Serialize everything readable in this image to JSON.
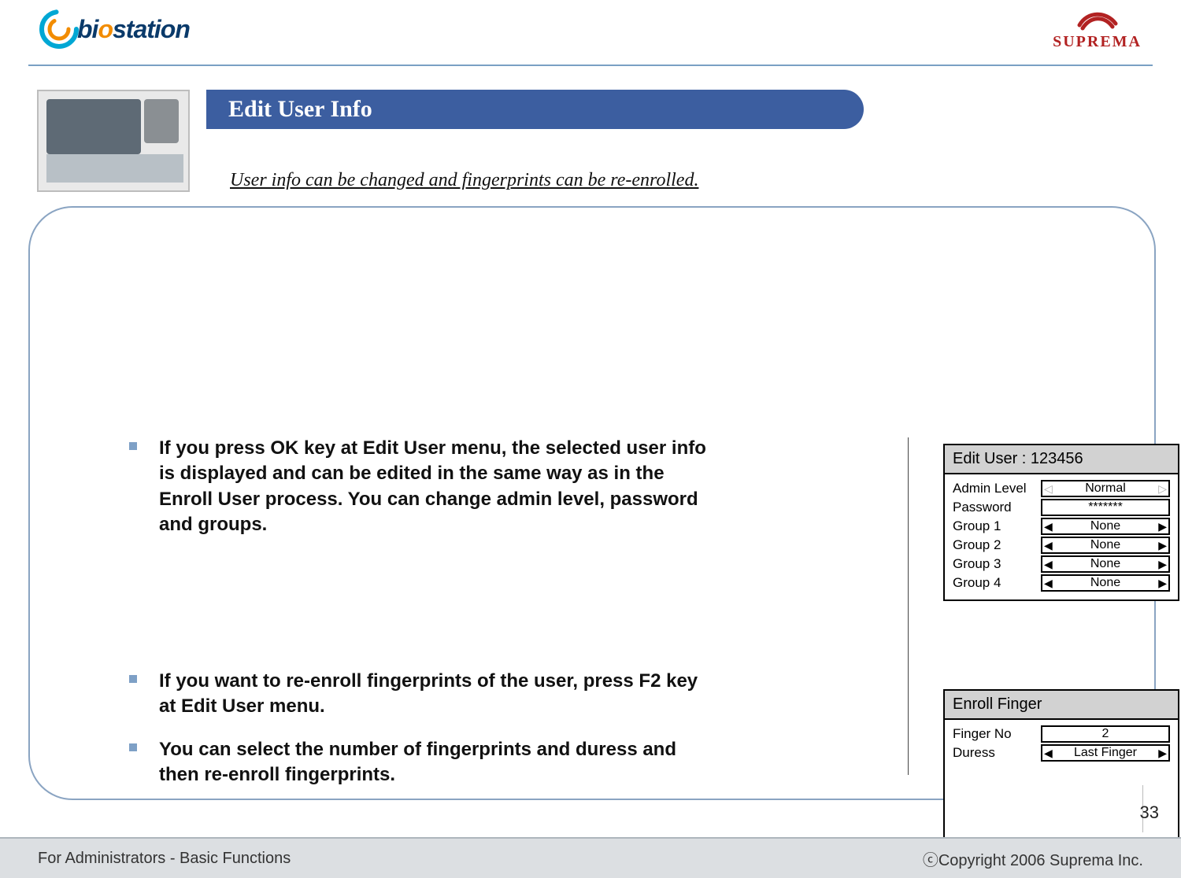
{
  "header": {
    "logo_biostation": "biostation",
    "logo_suprema": "SUPREMA"
  },
  "title": "Edit User Info",
  "subtitle": "User info can be changed and fingerprints can be re-enrolled.",
  "bullets_top": [
    "If you press OK key at Edit User menu, the selected user info is displayed and can be edited in the same way as in the Enroll User process. You can change admin level, password and groups."
  ],
  "bullets_bottom": [
    "If you want to re-enroll fingerprints of the user, press F2 key at Edit User menu.",
    "You can select the number of fingerprints and duress and then re-enroll fingerprints."
  ],
  "panel_edit": {
    "title": "Edit User : 123456",
    "rows": [
      {
        "label": "Admin Level",
        "value": "Normal",
        "dim_arrows": true
      },
      {
        "label": "Password",
        "value": "*******",
        "input": true
      },
      {
        "label": "Group 1",
        "value": "None"
      },
      {
        "label": "Group 2",
        "value": "None"
      },
      {
        "label": "Group 3",
        "value": "None"
      },
      {
        "label": "Group 4",
        "value": "None"
      }
    ]
  },
  "panel_enroll": {
    "title": "Enroll Finger",
    "rows": [
      {
        "label": "Finger No",
        "value": "2",
        "input": true
      },
      {
        "label": "Duress",
        "value": "Last Finger"
      }
    ]
  },
  "footer": {
    "left": "For Administrators - Basic Functions",
    "right": "ⓒCopyright 2006 Suprema Inc.",
    "page": "33"
  }
}
